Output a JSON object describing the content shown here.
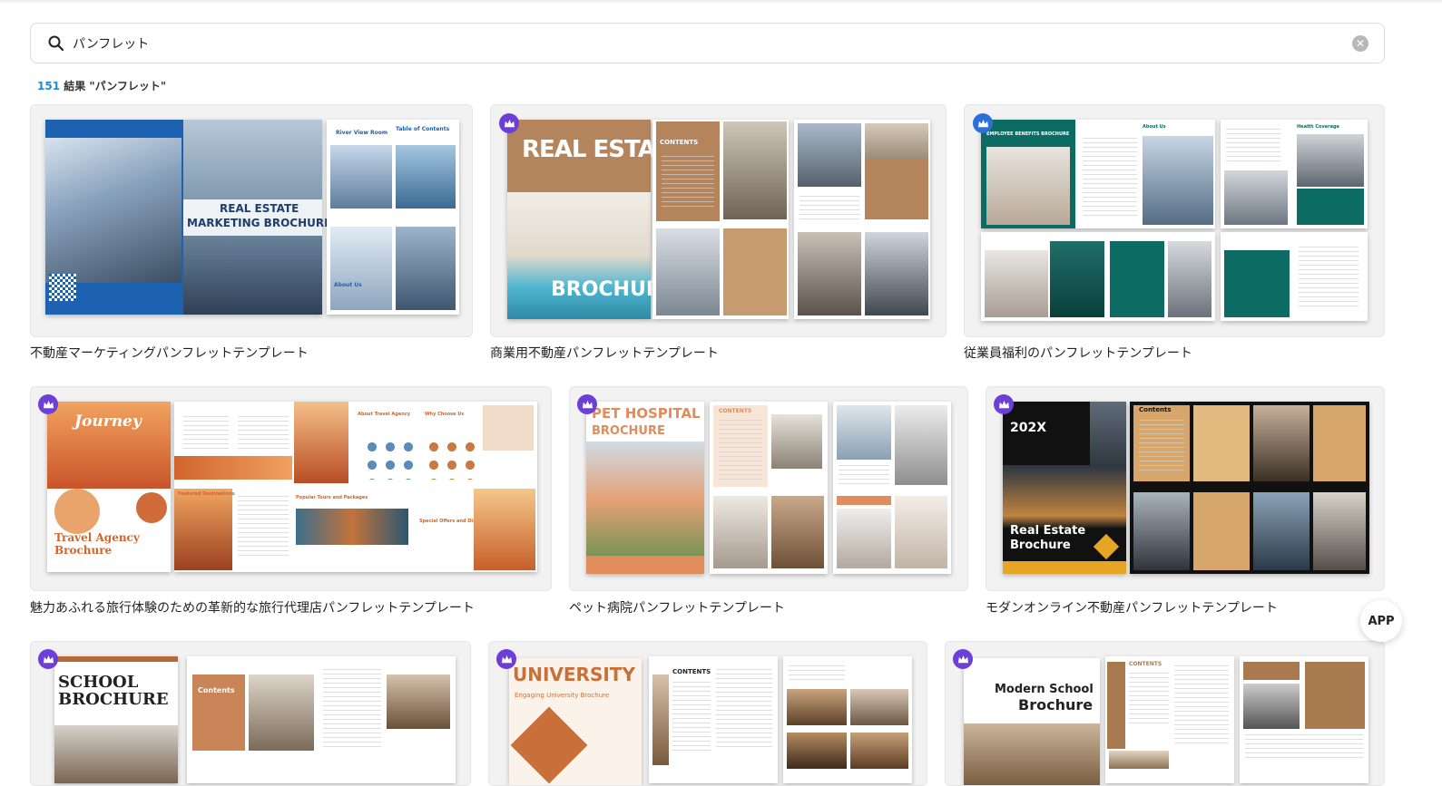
{
  "search": {
    "value": "パンフレット",
    "placeholder": ""
  },
  "results": {
    "count": "151",
    "label": "結果 \"パンフレット\""
  },
  "cards": [
    {
      "title": "不動産マーケティングパンフレットテンプレート",
      "premium": false,
      "cover_text": [
        "REAL ESTATE",
        "MARKETING BROCHURE"
      ],
      "inner_text": [
        "River View Room",
        "Table of Contents",
        "About Us"
      ]
    },
    {
      "title": "商業用不動産パンフレットテンプレート",
      "premium": true,
      "cover_text": [
        "REAL ESTATE",
        "BROCHURE"
      ],
      "inner_text": [
        "CONTENTS"
      ]
    },
    {
      "title": "従業員福利のパンフレットテンプレート",
      "premium": true,
      "cover_text": [
        "EMPLOYEE BENEFITS BROCHURE"
      ],
      "inner_text": [
        "About Us",
        "Health Coverage"
      ]
    },
    {
      "title": "魅力あふれる旅行体験のための革新的な旅行代理店パンフレットテンプレート",
      "premium": true,
      "cover_text": [
        "Journey",
        "Travel Agency",
        "Brochure"
      ],
      "inner_text": [
        "About Travel Agency",
        "Why Choose Us",
        "Featured Destinations",
        "Popular Tours and Packages",
        "Special Offers and Discounts"
      ]
    },
    {
      "title": "ペット病院パンフレットテンプレート",
      "premium": true,
      "cover_text": [
        "PET HOSPITAL",
        "BROCHURE"
      ],
      "inner_text": [
        "CONTENTS"
      ]
    },
    {
      "title": "モダンオンライン不動産パンフレットテンプレート",
      "premium": true,
      "cover_text": [
        "202X",
        "Real Estate",
        "Brochure"
      ],
      "inner_text": [
        "Contents"
      ]
    },
    {
      "title": "",
      "premium": true,
      "cover_text": [
        "SCHOOL",
        "BROCHURE"
      ],
      "inner_text": [
        "Contents"
      ]
    },
    {
      "title": "",
      "premium": true,
      "cover_text": [
        "UNIVERSITY",
        "Engaging University Brochure"
      ],
      "inner_text": [
        "CONTENTS"
      ]
    },
    {
      "title": "",
      "premium": true,
      "cover_text": [
        "Modern School",
        "Brochure"
      ],
      "inner_text": [
        "CONTENTS"
      ]
    }
  ],
  "app_button": "APP",
  "icons": {
    "search": "search-icon",
    "clear": "clear-icon",
    "premium": "crown-icon"
  },
  "colors": {
    "accent": "#1a8fd0",
    "premium_badge": "#6c3fd6"
  }
}
